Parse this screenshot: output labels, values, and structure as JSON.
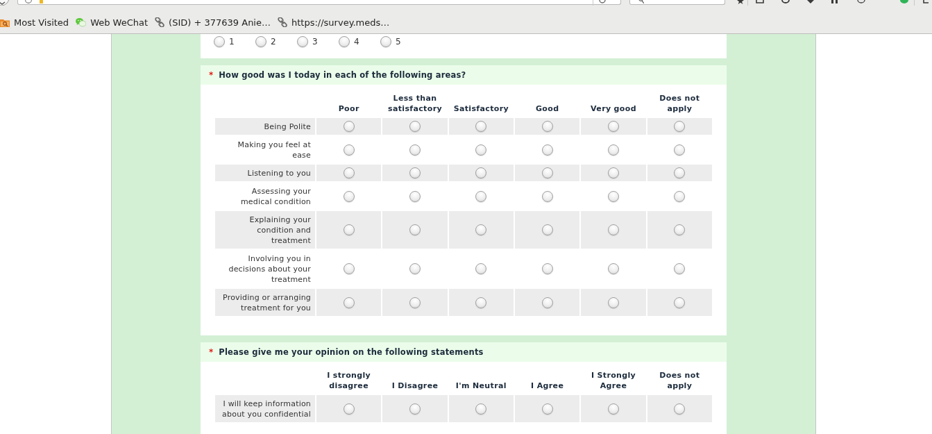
{
  "browser": {
    "bookmarks": [
      {
        "kind": "folder",
        "label": "Most Visited"
      },
      {
        "kind": "wechat",
        "label": "Web WeChat"
      },
      {
        "kind": "link",
        "label": "(SID) + 377639 Anie…"
      },
      {
        "kind": "link",
        "label": "https://survey.meds…"
      }
    ]
  },
  "questions": [
    {
      "kind": "scale",
      "options": [
        {
          "label": "1",
          "selected": false
        },
        {
          "label": "2",
          "selected": false
        },
        {
          "label": "3",
          "selected": false
        },
        {
          "label": "4",
          "selected": false
        },
        {
          "label": "5",
          "selected": false
        }
      ]
    },
    {
      "kind": "matrix",
      "required_marker": "*",
      "title": "How good was I today in each of the following areas?",
      "columns": [
        "Poor",
        "Less than\nsatisfactory",
        "Satisfactory",
        "Good",
        "Very good",
        "Does not\napply"
      ],
      "rows": [
        {
          "label": "Being Polite",
          "choices": [
            {
              "selected": false
            },
            {
              "selected": false
            },
            {
              "selected": false
            },
            {
              "selected": false
            },
            {
              "selected": false
            },
            {
              "selected": false
            }
          ]
        },
        {
          "label": "Making you feel at\nease",
          "choices": [
            {
              "selected": false
            },
            {
              "selected": false
            },
            {
              "selected": false
            },
            {
              "selected": false
            },
            {
              "selected": false
            },
            {
              "selected": false
            }
          ]
        },
        {
          "label": "Listening to you",
          "choices": [
            {
              "selected": false
            },
            {
              "selected": false
            },
            {
              "selected": false
            },
            {
              "selected": false
            },
            {
              "selected": false
            },
            {
              "selected": false
            }
          ]
        },
        {
          "label": "Assessing your\nmedical condition",
          "choices": [
            {
              "selected": false
            },
            {
              "selected": false
            },
            {
              "selected": false
            },
            {
              "selected": false
            },
            {
              "selected": false
            },
            {
              "selected": false
            }
          ]
        },
        {
          "label": "Explaining your\ncondition and\ntreatment",
          "choices": [
            {
              "selected": false
            },
            {
              "selected": false
            },
            {
              "selected": false
            },
            {
              "selected": false
            },
            {
              "selected": false
            },
            {
              "selected": false
            }
          ]
        },
        {
          "label": "Involving you in\ndecisions about your\ntreatment",
          "choices": [
            {
              "selected": false
            },
            {
              "selected": false
            },
            {
              "selected": false
            },
            {
              "selected": false
            },
            {
              "selected": false
            },
            {
              "selected": false
            }
          ]
        },
        {
          "label": "Providing or arranging\ntreatment for you",
          "choices": [
            {
              "selected": false
            },
            {
              "selected": false
            },
            {
              "selected": false
            },
            {
              "selected": false
            },
            {
              "selected": false
            },
            {
              "selected": false
            }
          ]
        }
      ]
    },
    {
      "kind": "matrix",
      "required_marker": "*",
      "title": "Please give me your opinion on the following statements",
      "columns": [
        "I strongly\ndisagree",
        "I Disagree",
        "I'm Neutral",
        "I Agree",
        "I Strongly\nAgree",
        "Does not\napply"
      ],
      "rows": [
        {
          "label": "I will keep information\nabout you confidential",
          "choices": [
            {
              "selected": false
            },
            {
              "selected": false
            },
            {
              "selected": false
            },
            {
              "selected": false
            },
            {
              "selected": false
            },
            {
              "selected": false
            }
          ]
        }
      ]
    }
  ]
}
